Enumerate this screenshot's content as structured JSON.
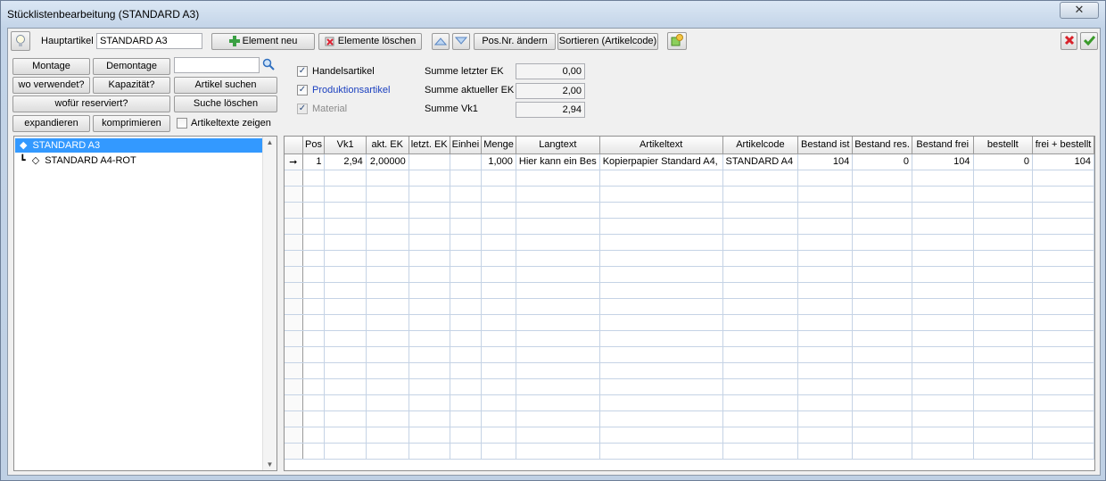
{
  "window": {
    "title": "Stücklistenbearbeitung (STANDARD A3)",
    "close_symbol": "✕"
  },
  "toolbar": {
    "hauptartikel_label": "Hauptartikel",
    "hauptartikel_value": "STANDARD A3",
    "element_neu": "Element neu",
    "elemente_loeschen": "Elemente löschen",
    "pos_nr_aendern": "Pos.Nr. ändern",
    "sortieren": "Sortieren (Artikelcode)"
  },
  "buttons": {
    "montage": "Montage",
    "demontage": "Demontage",
    "wo_verwendet": "wo verwendet?",
    "kapazitaet": "Kapazität?",
    "artikel_suchen": "Artikel suchen",
    "wofuer_reserviert": "wofür reserviert?",
    "suche_loeschen": "Suche löschen",
    "expandieren": "expandieren",
    "komprimieren": "komprimieren",
    "artikeltexte_zeigen": "Artikeltexte zeigen"
  },
  "search": {
    "value": ""
  },
  "filters": {
    "handelsartikel": "Handelsartikel",
    "produktionsartikel": "Produktionsartikel",
    "material": "Material"
  },
  "sums": {
    "letzter_ek_label": "Summe letzter EK",
    "letzter_ek_value": "0,00",
    "aktueller_ek_label": "Summe aktueller EK",
    "aktueller_ek_value": "2,00",
    "vk1_label": "Summe Vk1",
    "vk1_value": "2,94"
  },
  "tree": {
    "root": "STANDARD A3",
    "child": "STANDARD A4-ROT"
  },
  "grid": {
    "columns": [
      "Pos",
      "Vk1",
      "akt. EK",
      "letzt. EK",
      "Einhei",
      "Menge",
      "Langtext",
      "Artikeltext",
      "Artikelcode",
      "Bestand ist",
      "Bestand res.",
      "Bestand frei",
      "bestellt",
      "frei + bestellt"
    ],
    "rows": [
      [
        "1",
        "2,94",
        "2,00000",
        "",
        "",
        "1,000",
        "Hier kann ein Bes",
        "Kopierpapier Standard A4,",
        "STANDARD A4",
        "104",
        "0",
        "104",
        "0",
        "104"
      ]
    ],
    "row_indicator": "➞",
    "empty_rows": 18
  },
  "colors": {
    "selection": "#3399ff",
    "accent_blue": "#1a3fbf"
  }
}
